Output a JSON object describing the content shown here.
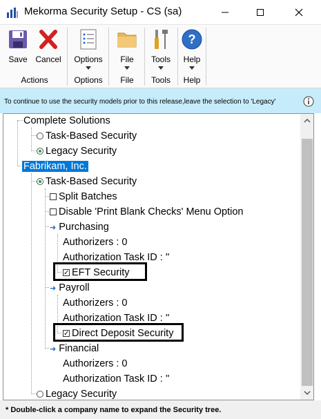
{
  "window": {
    "title": "Mekorma Security Setup  -  CS (sa)",
    "minimize_icon": "minimize-icon",
    "maximize_icon": "maximize-icon",
    "close_icon": "close-icon"
  },
  "ribbon": {
    "buttons": [
      {
        "label": "Save",
        "icon": "save-icon"
      },
      {
        "label": "Cancel",
        "icon": "cancel-icon"
      },
      {
        "label": "Options",
        "icon": "options-icon"
      },
      {
        "label": "File",
        "icon": "folder-icon"
      },
      {
        "label": "Tools",
        "icon": "tools-icon"
      },
      {
        "label": "Help",
        "icon": "help-icon"
      }
    ],
    "groups": [
      "Actions",
      "Options",
      "File",
      "Tools",
      "Help"
    ]
  },
  "info": {
    "text": "To continue to use the security models prior to this release,leave the selection to 'Legacy'",
    "icon": "info-icon"
  },
  "tree": {
    "company1": "Complete Solutions",
    "c1_task": "Task-Based Security",
    "c1_task_selected": false,
    "c1_legacy": "Legacy Security",
    "c1_legacy_selected": true,
    "company2": "Fabrikam, Inc.",
    "c2_task": "Task-Based Security",
    "c2_task_selected": true,
    "split_batches": "Split Batches",
    "split_batches_checked": false,
    "disable_print": "Disable 'Print Blank Checks' Menu Option",
    "disable_print_checked": false,
    "purchasing": "Purchasing",
    "purchasing_authorizers": "Authorizers : 0",
    "purchasing_task_id": "Authorization Task ID : ''",
    "eft_security": "EFT Security",
    "eft_security_checked": true,
    "payroll": "Payroll",
    "payroll_authorizers": "Authorizers : 0",
    "payroll_task_id": "Authorization Task ID : ''",
    "direct_deposit": "Direct Deposit Security",
    "direct_deposit_checked": true,
    "financial": "Financial",
    "financial_authorizers": "Authorizers : 0",
    "financial_task_id": "Authorization Task ID : ''",
    "c2_legacy": "Legacy Security",
    "c2_legacy_selected": false
  },
  "footer": {
    "text": "* Double-click a company name to expand the Security tree."
  },
  "colors": {
    "selection": "#0078d7",
    "info_bar": "#c6ecfb",
    "radio_on": "#1aa34a",
    "arrow": "#1e6bd6"
  }
}
